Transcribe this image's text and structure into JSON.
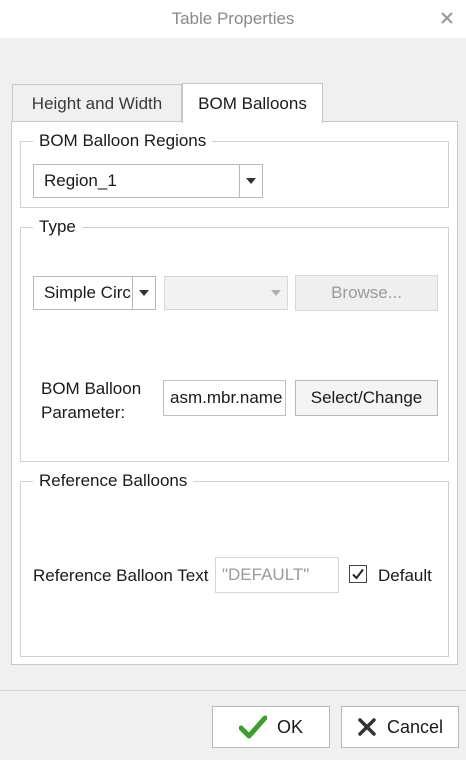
{
  "window": {
    "title": "Table Properties"
  },
  "tabs": [
    {
      "label": "Height and Width",
      "active": false
    },
    {
      "label": "BOM Balloons",
      "active": true
    }
  ],
  "regions": {
    "legend": "BOM Balloon Regions",
    "selected": "Region_1"
  },
  "type": {
    "legend": "Type",
    "style_selected": "Simple Circle",
    "secondary_selected": "",
    "browse_label": "Browse...",
    "parameter_label_line1": "BOM Balloon",
    "parameter_label_line2": "Parameter:",
    "parameter_value": "asm.mbr.name",
    "select_change_label": "Select/Change"
  },
  "reference": {
    "legend": "Reference Balloons",
    "text_label": "Reference Balloon Text",
    "text_placeholder": "\"DEFAULT\"",
    "default_label": "Default",
    "default_checked": true
  },
  "footer": {
    "ok_label": "OK",
    "cancel_label": "Cancel"
  },
  "colors": {
    "ok_check": "#3aa02a",
    "cancel_x": "#333333"
  }
}
